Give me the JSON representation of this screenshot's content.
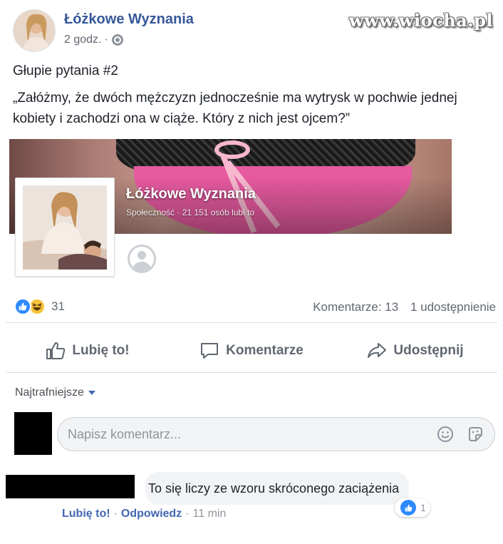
{
  "post": {
    "page_name": "Łóżkowe Wyznania",
    "time": "2 godz.",
    "separator": "·",
    "privacy_icon": "globe-icon",
    "title": "Głupie pytania #2",
    "body": "„Załóżmy, że dwóch mężczyzn jednocześnie ma wytrysk w pochwie jednej kobiety i zachodzi ona w ciąże. Który z nich jest ojcem?”"
  },
  "watermark": "www.wiocha.pl",
  "shared_page": {
    "title": "Łóżkowe Wyznania",
    "subtitle": "Społeczność · 21 151 osób lubi to"
  },
  "stats": {
    "reaction_icons": [
      "like-icon",
      "haha-icon"
    ],
    "reaction_count": "31",
    "comments": "Komentarze: 13",
    "shares": "1 udostępnienie"
  },
  "actions": {
    "like": "Lubię to!",
    "comment": "Komentarze",
    "share": "Udostępnij"
  },
  "comments_section": {
    "sort_label": "Najtrafniejsze",
    "input_placeholder": "Napisz komentarz...",
    "comment": {
      "text": "To się liczy ze wzoru skróconego zaciążenia",
      "reaction_count": "1",
      "like": "Lubię to!",
      "reply": "Odpowiedz",
      "separator": "·",
      "time": "11 min"
    }
  },
  "colors": {
    "link_blue": "#365899",
    "facebook_blue": "#4267b2",
    "like_blue": "#2e89ff",
    "muted_gray": "#606770"
  }
}
